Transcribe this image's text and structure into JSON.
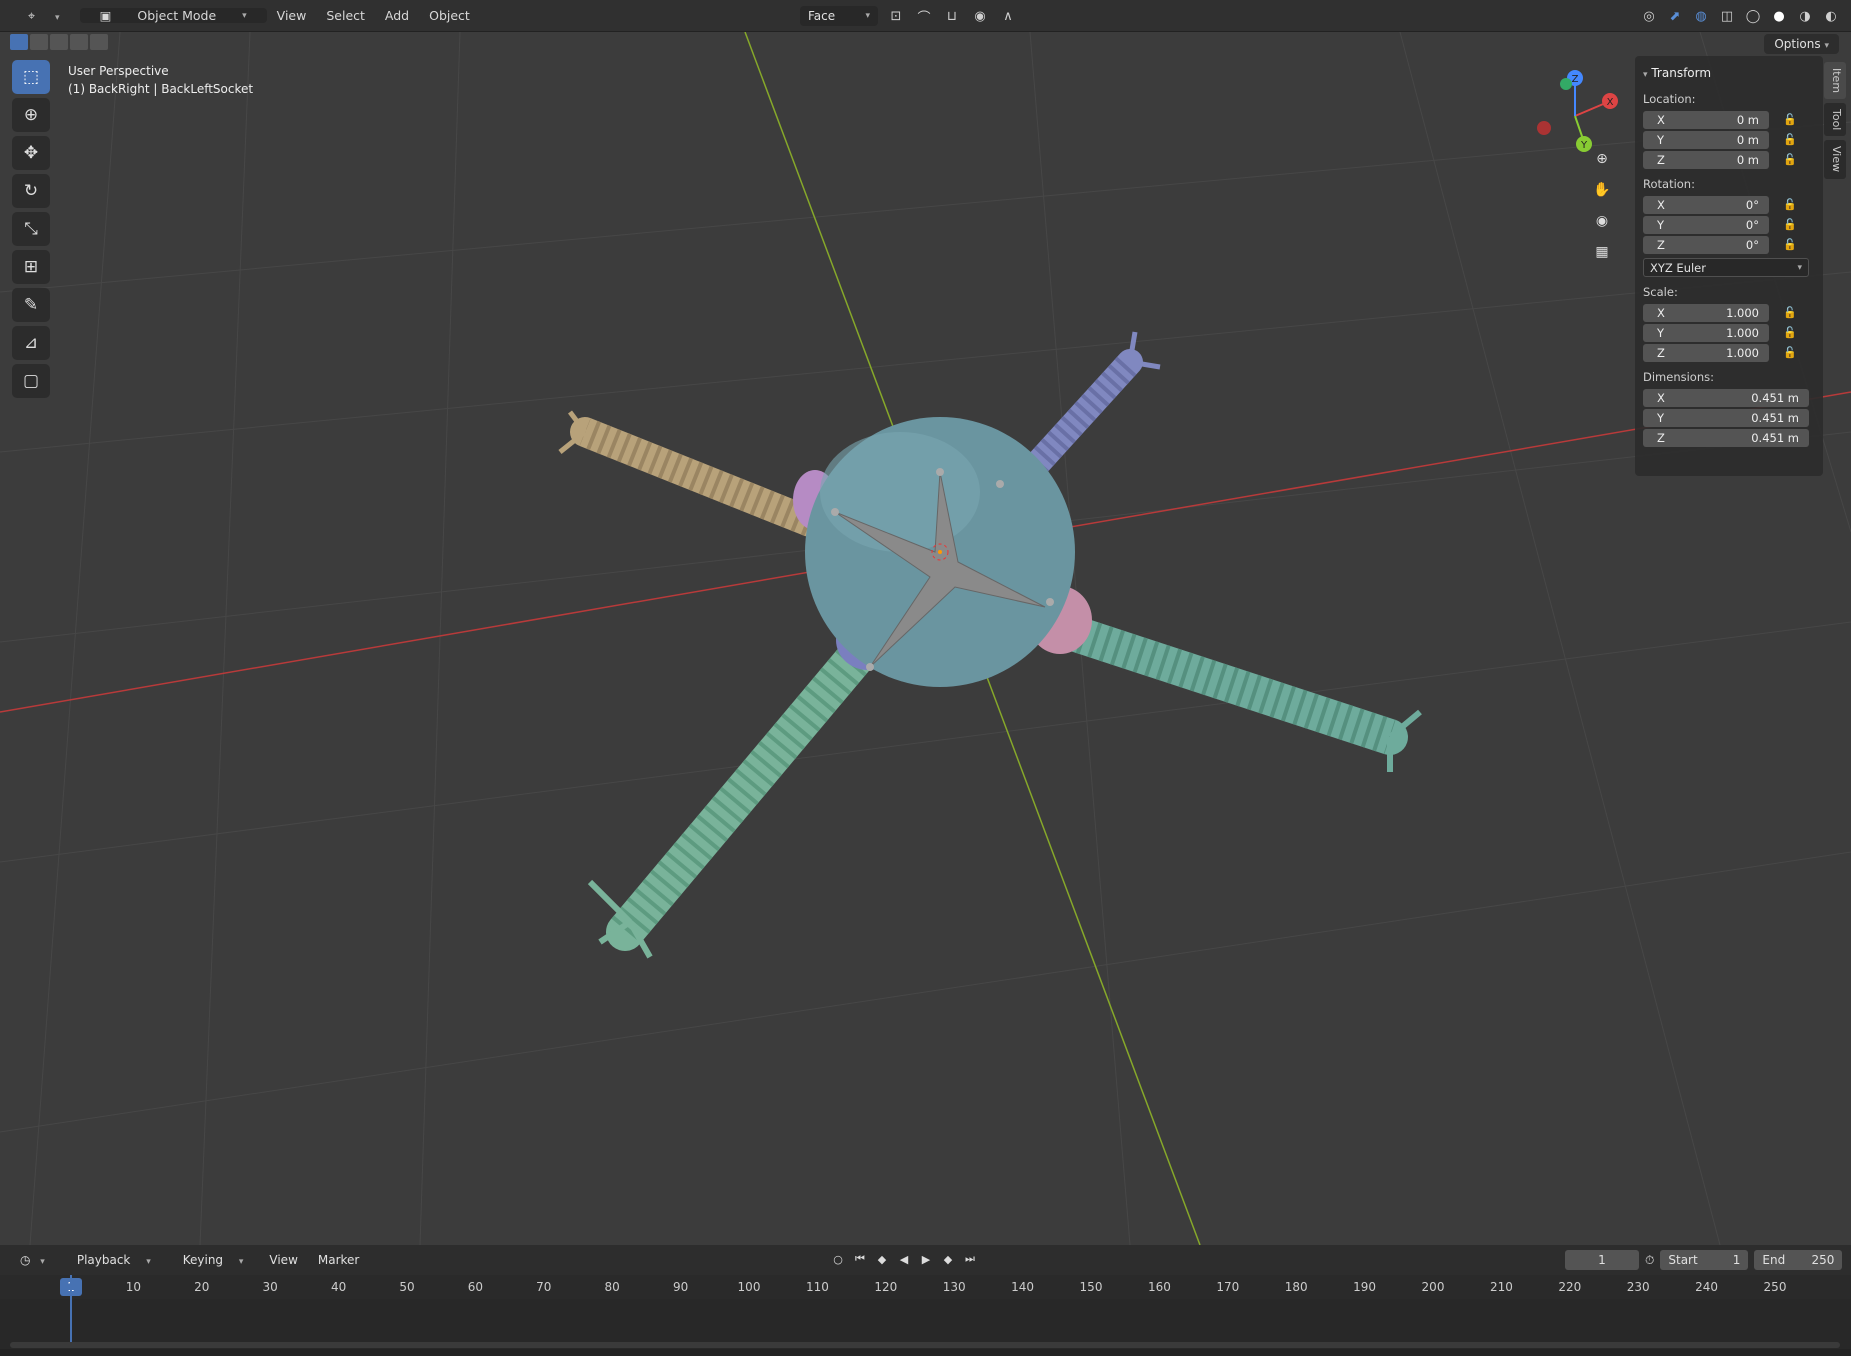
{
  "header": {
    "mode": "Object Mode",
    "menus": [
      "View",
      "Select",
      "Add",
      "Object"
    ],
    "orientation": "Face"
  },
  "viewport": {
    "perspective": "User Perspective",
    "object_info": "(1) BackRight | BackLeftSocket",
    "options_label": "Options"
  },
  "npanel": {
    "tabs": [
      "Item",
      "Tool",
      "View"
    ],
    "title": "Transform",
    "location": {
      "label": "Location:",
      "x": "0 m",
      "y": "0 m",
      "z": "0 m"
    },
    "rotation": {
      "label": "Rotation:",
      "x": "0°",
      "y": "0°",
      "z": "0°"
    },
    "rotation_mode": "XYZ Euler",
    "scale": {
      "label": "Scale:",
      "x": "1.000",
      "y": "1.000",
      "z": "1.000"
    },
    "dimensions": {
      "label": "Dimensions:",
      "x": "0.451 m",
      "y": "0.451 m",
      "z": "0.451 m"
    },
    "axes": [
      "X",
      "Y",
      "Z"
    ]
  },
  "gizmo": {
    "x": "X",
    "y": "Y",
    "z": "Z"
  },
  "timeline": {
    "menus": [
      "Playback",
      "Keying",
      "View",
      "Marker"
    ],
    "current_frame": "1",
    "start_label": "Start",
    "start_value": "1",
    "end_label": "End",
    "end_value": "250",
    "ticks": [
      "10",
      "20",
      "30",
      "40",
      "50",
      "60",
      "70",
      "80",
      "90",
      "100",
      "110",
      "120",
      "130",
      "140",
      "150",
      "160",
      "170",
      "180",
      "190",
      "200",
      "210",
      "220",
      "230",
      "240",
      "250"
    ]
  },
  "colors": {
    "accent": "#4772b3",
    "viewport_bg": "#3c3c3c",
    "sphere": "#6a95a0",
    "leg_tan": "#b8a27a",
    "leg_blue": "#8088c0",
    "leg_green": "#79b39a",
    "leg_teal": "#6eab9c",
    "axis_x": "#b83a3a",
    "axis_y": "#86a82a"
  }
}
